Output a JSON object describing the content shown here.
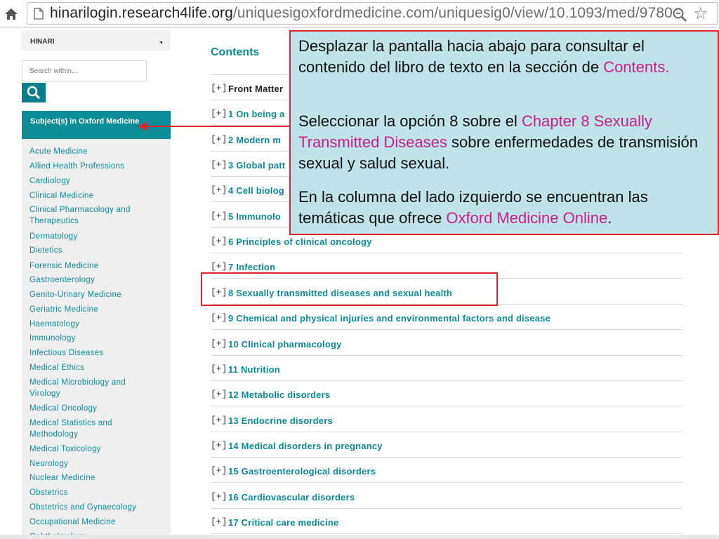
{
  "browser": {
    "url_host": "hinarilogin.research4life.org",
    "url_path": "/uniquesigoxfordmedicine.com/uniquesig0/view/10.1093/med/9780",
    "star_glyph": "☆",
    "icons": [
      "home-icon",
      "page-icon",
      "zoom-icon",
      "star-icon"
    ]
  },
  "sidebar": {
    "header_title": "HINARI",
    "search_placeholder": "Search within...",
    "active_item": "Subject(s) in Oxford Medicine",
    "items": [
      "Acute Medicine",
      "Allied Health Professions",
      "Cardiology",
      "Clinical Medicine",
      "Clinical Pharmacology and Therapeutics",
      "Dermatology",
      "Dietetics",
      "Forensic Medicine",
      "Gastroenterology",
      "Genito-Urinary Medicine",
      "Geriatric Medicine",
      "Haematology",
      "Immunology",
      "Infectious Diseases",
      "Medical Ethics",
      "Medical Microbiology and Virology",
      "Medical Oncology",
      "Medical Statistics and Methodology",
      "Medical Toxicology",
      "Neurology",
      "Nuclear Medicine",
      "Obstetrics",
      "Obstetrics and Gynaecology",
      "Occupational Medicine",
      "Ophthalmology"
    ]
  },
  "contents": {
    "title": "Contents",
    "expand_glyph": "[+]",
    "rows": [
      "Front Matter",
      "1 On being a",
      "2 Modern m",
      "3 Global patt",
      "4 Cell biolog",
      "5 Immunolo",
      "6 Principles of clinical oncology",
      "7 Infection",
      "8 Sexually transmitted diseases and sexual health",
      "9 Chemical and physical injuries and environmental factors and disease",
      "10 Clinical pharmacology",
      "11 Nutrition",
      "12 Metabolic disorders",
      "13 Endocrine disorders",
      "14 Medical disorders in pregnancy",
      "15 Gastroenterological disorders",
      "16 Cardiovascular disorders",
      "17 Critical care medicine"
    ]
  },
  "callout": {
    "p1_text": "Desplazar la pantalla hacia abajo para consultar el contenido del libro de texto en la sección de ",
    "p1_highlight": "Contents.",
    "p2_text_a": "Seleccionar la opción 8 sobre el ",
    "p2_highlight": "Chapter 8 Sexually Transmitted Diseases",
    "p2_text_b": " sobre enfermedades de transmisión sexual y salud sexual.",
    "p3_text_a": "En la columna del lado izquierdo se encuentran las temáticas que ofrece ",
    "p3_highlight": "Oxford Medicine Online",
    "p3_text_b": "."
  },
  "colors": {
    "accent": "#0b8c97",
    "highlight_text": "#c7208a",
    "callout_bg": "#bfe3e9",
    "callout_border": "#e0262b"
  }
}
